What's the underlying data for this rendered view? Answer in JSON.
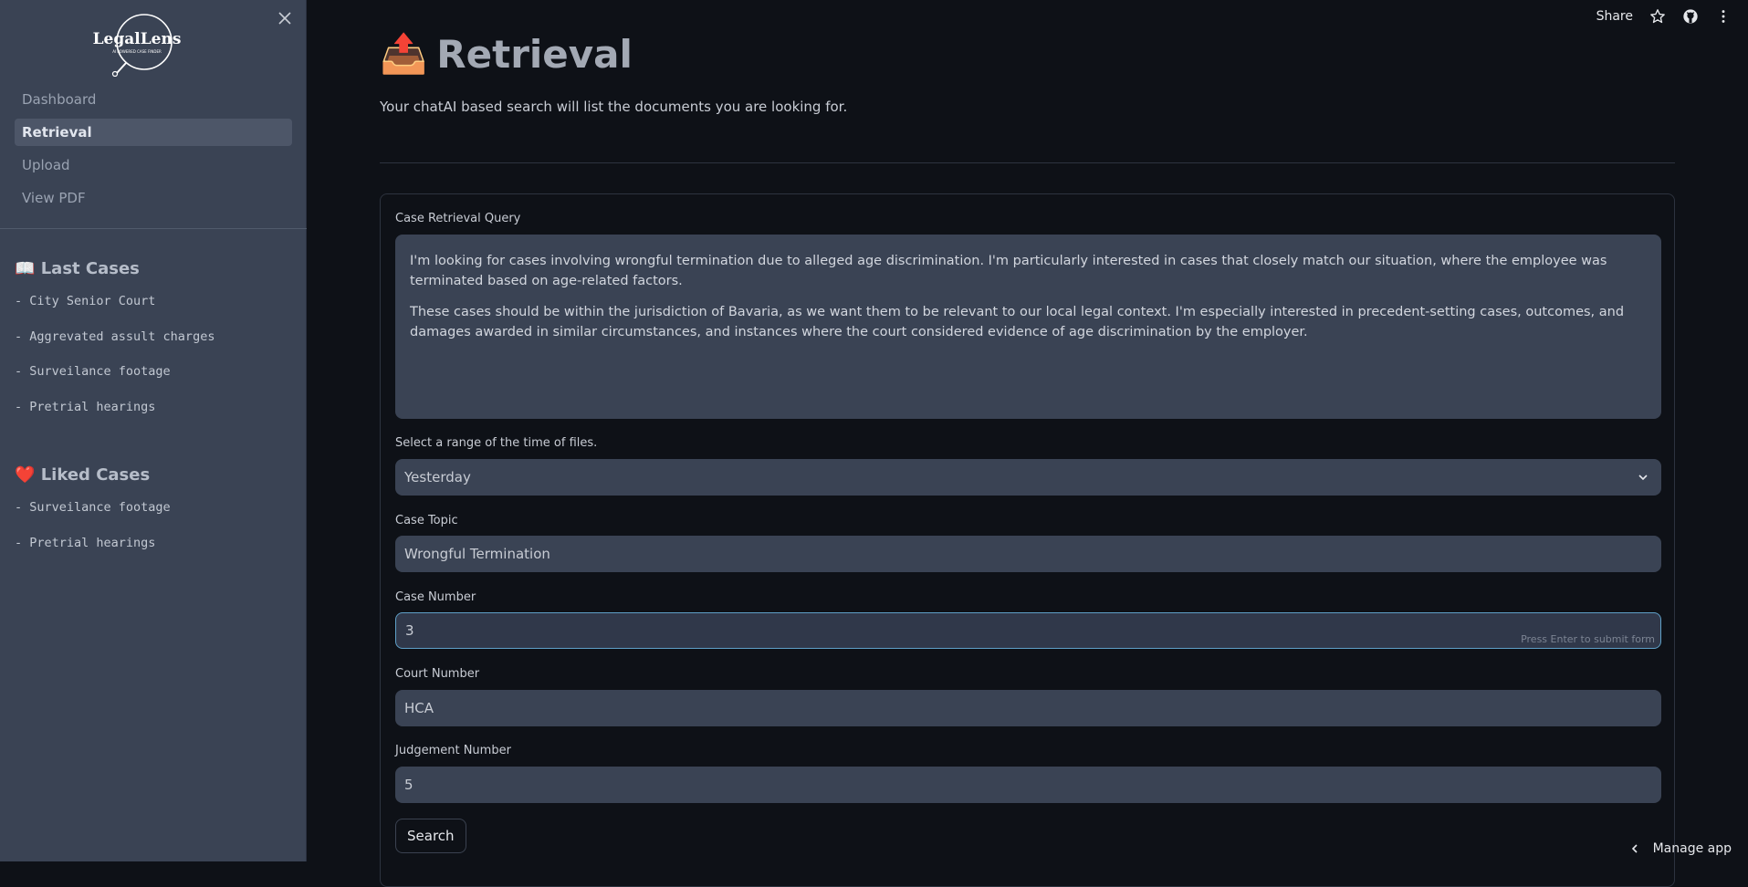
{
  "sidebar": {
    "logo_text": "LegalLens",
    "logo_tagline": "AI POWERED CASE FINDER",
    "nav": [
      {
        "label": "Dashboard"
      },
      {
        "label": "Retrieval"
      },
      {
        "label": "Upload"
      },
      {
        "label": "View PDF"
      }
    ],
    "last_cases": {
      "icon": "📖",
      "title": "Last Cases",
      "items": [
        "- City Senior Court",
        "- Aggrevated assult charges",
        "- Surveilance footage",
        "- Pretrial hearings"
      ]
    },
    "liked_cases": {
      "icon": "❤️",
      "title": "Liked Cases",
      "items": [
        "- Surveilance footage",
        "- Pretrial hearings"
      ]
    }
  },
  "topbar": {
    "share_label": "Share",
    "manage_label": "Manage app"
  },
  "page": {
    "title_icon": "📤",
    "title": "Retrieval",
    "subtitle": "Your chatAI based search will list the documents you are looking for."
  },
  "form": {
    "query_label": "Case Retrieval Query",
    "query_p1": "I'm looking for cases involving wrongful termination due to alleged age discrimination. I'm particularly interested in cases that closely match our situation, where the employee was terminated based on age-related factors.",
    "query_p2": "These cases should be within the jurisdiction of Bavaria, as we want them to be relevant to our local legal context. I'm especially interested in precedent-setting cases, outcomes, and damages awarded in similar circumstances, and instances where the court considered evidence of age discrimination by the employer.",
    "range_label": "Select a range of the time of files.",
    "range_value": "Yesterday",
    "topic_label": "Case Topic",
    "topic_value": "Wrongful Termination",
    "case_number_label": "Case Number",
    "case_number_value": "3",
    "case_number_hint": "Press Enter to submit form",
    "court_number_label": "Court Number",
    "court_number_value": "HCA",
    "judgement_label": "Judgement Number",
    "judgement_value": "5",
    "search_label": "Search"
  }
}
